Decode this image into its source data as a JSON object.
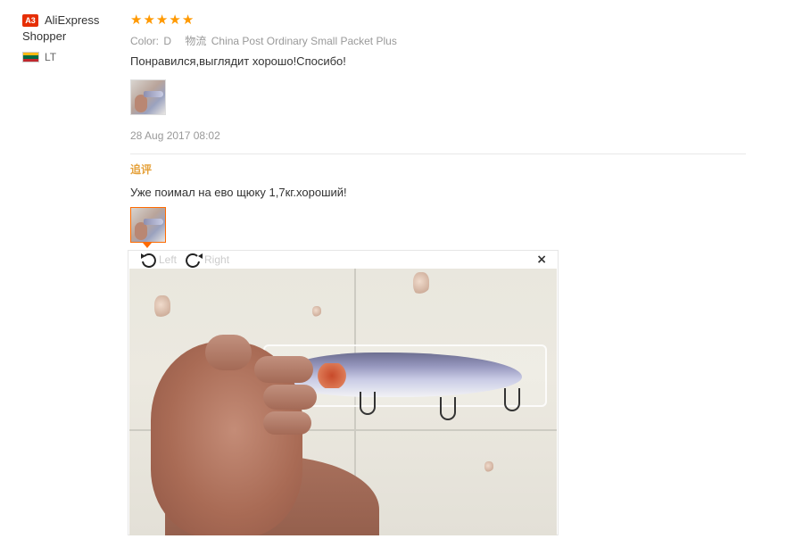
{
  "user": {
    "badge": "A3",
    "name_line1": "AliExpress",
    "name_line2": "Shopper",
    "country_code": "LT",
    "flag_colors": [
      "#fdb913",
      "#006a44",
      "#c1272d"
    ]
  },
  "review": {
    "stars": 5,
    "star_glyph": "★",
    "color_label": "Color:",
    "color_value": "D",
    "logistics_label": "物流",
    "logistics_value": "China Post Ordinary Small Packet Plus",
    "text": "Понравился,выглядит хорошо!Спосибо!",
    "date": "28 Aug 2017 08:02",
    "followup_label": "追评",
    "followup_text": "Уже поимал на ево щюку 1,7кг.хороший!"
  },
  "viewer": {
    "rotate_left_label": "Left",
    "rotate_right_label": "Right",
    "close_glyph": "×"
  },
  "colors": {
    "accent_orange": "#ff6a00",
    "star": "#ff9900",
    "followup": "#e5a13a",
    "badge_red": "#e62e04"
  }
}
